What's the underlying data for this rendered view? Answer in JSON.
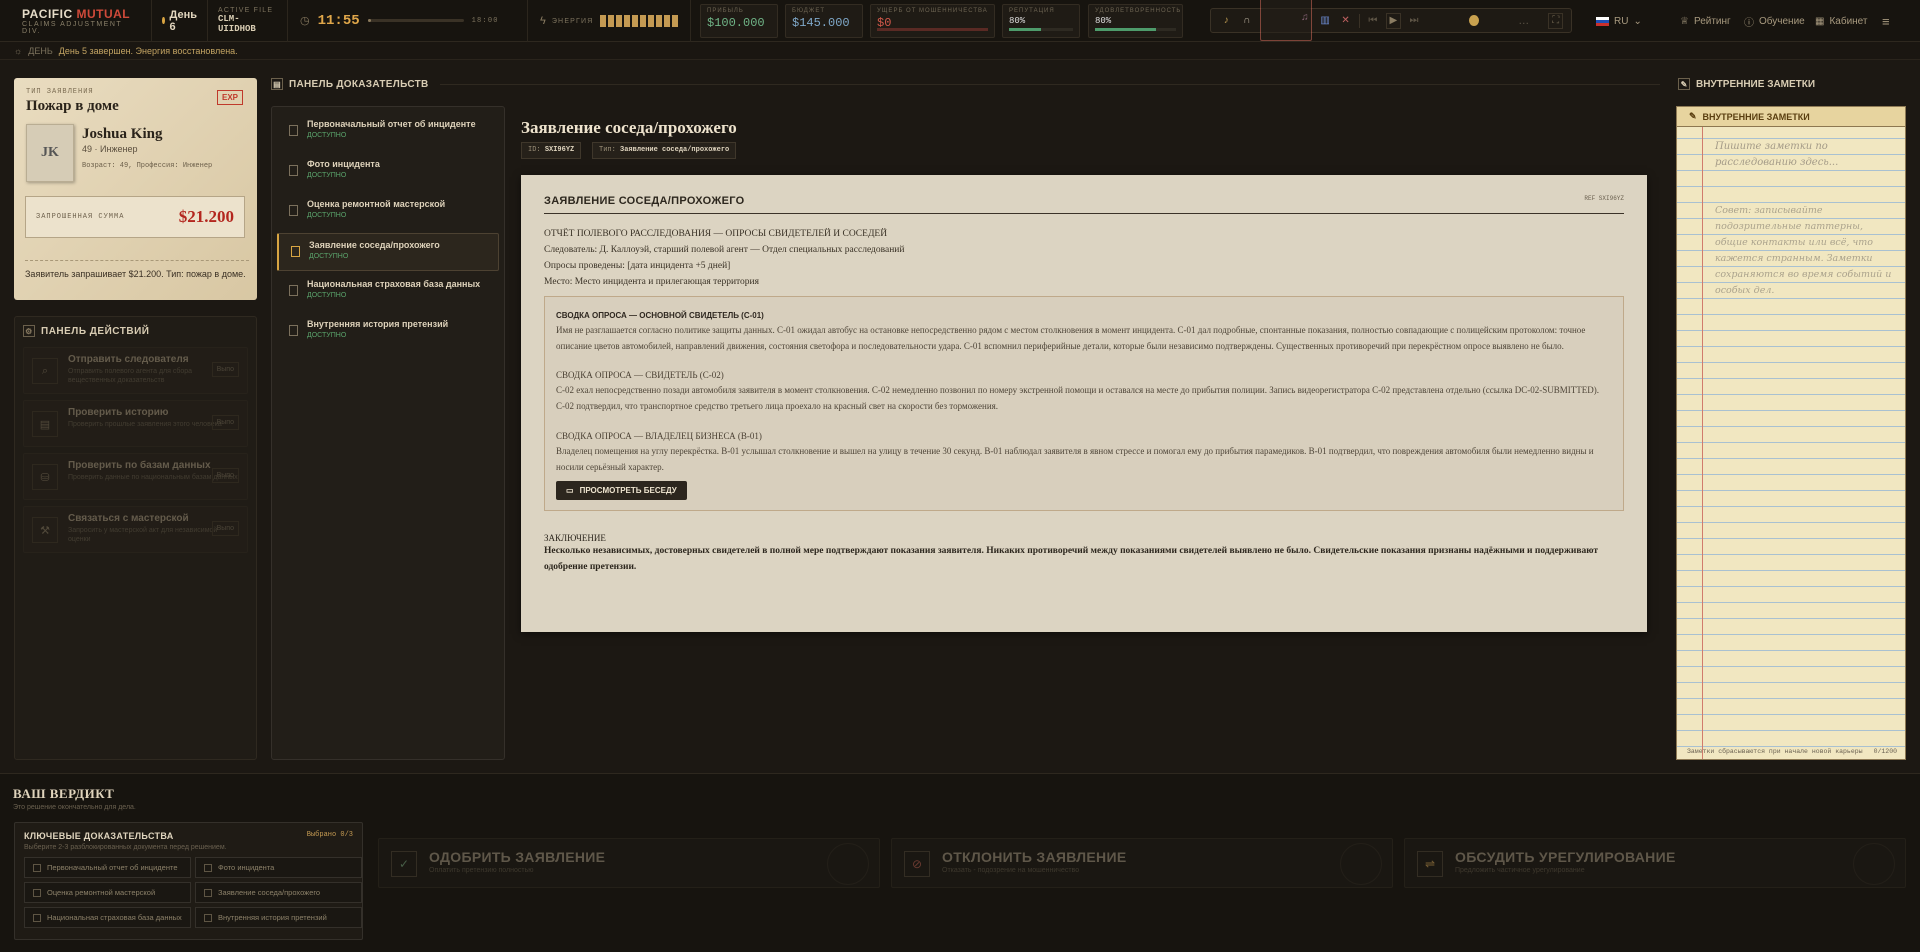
{
  "topbar": {
    "brand_main": "PACIFIC",
    "brand_accent": "MUTUAL",
    "brand_sub": "CLAIMS ADJUSTMENT DIV.",
    "day": "День 6",
    "active_file_label": "ACTIVE FILE",
    "active_file": "CLM-UIIDHOB",
    "time": "11:55",
    "time_end": "18:00",
    "day_progress": 0.04,
    "energy_label": "ЭНЕРГИЯ",
    "energy_segments": 10,
    "stats": {
      "profit_label": "ПРИБЫЛЬ",
      "profit": "$100.000",
      "budget_label": "БЮДЖЕТ",
      "budget": "$145.000",
      "fraud_label": "УЩЕРБ ОТ МОШЕННИЧЕСТВА",
      "fraud": "$0",
      "reputation_label": "РЕПУТАЦИЯ",
      "reputation": "80%",
      "satisfaction_label": "УДОВЛЕТВОРЕННОСТЬ",
      "satisfaction": "80%"
    },
    "language": "RU",
    "nav": {
      "rating": "Рейтинг",
      "training": "Обучение",
      "cabinet": "Кабинет"
    }
  },
  "notification": {
    "label": "ДЕНЬ",
    "text": "День 5 завершен. Энергия восстановлена."
  },
  "claim": {
    "type_label": "ТИП ЗАЯВЛЕНИЯ",
    "type": "Пожар в доме",
    "badge": "EXP",
    "initials": "JK",
    "name": "Joshua King",
    "info": "49 · Инженер",
    "meta": "Возраст: 49, Профессия: Инженер",
    "sum_label": "ЗАПРОШЕННАЯ СУММА",
    "sum": "$21.200",
    "description": "Заявитель запрашивает $21.200. Тип: пожар в доме."
  },
  "actions": {
    "title": "ПАНЕЛЬ ДЕЙСТВИЙ",
    "items": [
      {
        "title": "Отправить следователя",
        "desc": "Отправить полевого агента для сбора вещественных доказательств",
        "btn": "Выпо"
      },
      {
        "title": "Проверить историю",
        "desc": "Проверить прошлые заявления этого человека",
        "btn": "Выпо"
      },
      {
        "title": "Проверить по базам данных",
        "desc": "Проверить данные по национальным базам данных",
        "btn": "Выпо"
      },
      {
        "title": "Связаться с мастерской",
        "desc": "Запросить у мастерской акт для независимой оценки",
        "btn": "Выпо"
      }
    ]
  },
  "evidence": {
    "title": "ПАНЕЛЬ ДОКАЗАТЕЛЬСТВ",
    "items": [
      {
        "title": "Первоначальный отчет об инциденте",
        "status": "ДОСТУПНО"
      },
      {
        "title": "Фото инцидента",
        "status": "ДОСТУПНО"
      },
      {
        "title": "Оценка ремонтной мастерской",
        "status": "ДОСТУПНО"
      },
      {
        "title": "Заявление соседа/прохожего",
        "status": "ДОСТУПНО"
      },
      {
        "title": "Национальная страховая база данных",
        "status": "ДОСТУПНО"
      },
      {
        "title": "Внутренняя история претензий",
        "status": "ДОСТУПНО"
      }
    ]
  },
  "document": {
    "title": "Заявление соседа/прохожего",
    "id_label": "ID:",
    "id": "SXI96YZ",
    "type_label": "Тип:",
    "type": "Заявление соседа/прохожего",
    "header": "ЗАЯВЛЕНИЕ СОСЕДА/ПРОХОЖЕГО",
    "ref": "REF SXI96YZ",
    "meta": [
      "ОТЧЁТ ПОЛЕВОГО РАССЛЕДОВАНИЯ — ОПРОСЫ СВИДЕТЕЛЕЙ И СОСЕДЕЙ",
      "Следователь: Д. Каллоуэй, старший полевой агент — Отдел специальных расследований",
      "Опросы проведены: [дата инцидента +5 дней]",
      "Место: Место инцидента и прилегающая территория"
    ],
    "summary_title": "СВОДКА ОПРОСА — ОСНОВНОЙ СВИДЕТЕЛЬ (С-01)",
    "summary_text": "Имя не разглашается согласно политике защиты данных. С-01 ожидал автобус на остановке непосредственно рядом с местом столкновения в момент инцидента. С-01 дал подробные, спонтанные показания, полностью совпадающие с полицейским протоколом: точное описание цветов автомобилей, направлений движения, состояния светофора и последовательности удара. С-01 вспомнил периферийные детали, которые были независимо подтверждены. Существенных противоречий при перекрёстном опросе выявлено не было.",
    "w2_title": "СВОДКА ОПРОСА — СВИДЕТЕЛЬ (С-02)",
    "w2_text": "С-02 ехал непосредственно позади автомобиля заявителя в момент столкновения. С-02 немедленно позвонил по номеру экстренной помощи и оставался на месте до прибытия полиции. Запись видеорегистратора С-02 представлена отдельно (ссылка DC-02-SUBMITTED). С-02 подтвердил, что транспортное средство третьего лица проехало на красный свет на скорости без торможения.",
    "w3_title": "СВОДКА ОПРОСА — ВЛАДЕЛЕЦ БИЗНЕСА (В-01)",
    "w3_text": "Владелец помещения на углу перекрёстка. В-01 услышал столкновение и вышел на улицу в течение 30 секунд. В-01 наблюдал заявителя в явном стрессе и помогал ему до прибытия парамедиков. В-01 подтвердил, что повреждения автомобиля были немедленно видны и носили серьёзный характер.",
    "conv_button": "ПРОСМОТРЕТЬ БЕСЕДУ",
    "conclusion_title": "ЗАКЛЮЧЕНИЕ",
    "conclusion": "Несколько независимых, достоверных свидетелей в полной мере подтверждают показания заявителя. Никаких противоречий между показаниями свидетелей выявлено не было. Свидетельские показания признаны надёжными и поддерживают одобрение претензии."
  },
  "notes": {
    "title": "ВНУТРЕННИЕ ЗАМЕТКИ",
    "inner_title": "ВНУТРЕННИЕ ЗАМЕТКИ",
    "placeholder": "Пишите заметки по расследованию здесь...",
    "tip": "Совет: записывайте подозрительные паттерны, общие контакты или всё, что кажется странным. Заметки сохраняются во время событий и особых дел.",
    "footer_left": "Заметки сбрасываются при начале новой карьеры",
    "footer_right": "0/1200"
  },
  "verdict": {
    "title": "ВАШ ВЕРДИКТ",
    "subtitle": "Это решение окончательно для дела.",
    "key_title": "КЛЮЧЕВЫЕ ДОКАЗАТЕЛЬСТВА",
    "key_count": "Выбрано 0/3",
    "key_sub": "Выберите 2-3 разблокированных документа перед решением.",
    "key_items": [
      "Первоначальный отчет об инциденте",
      "Фото инцидента",
      "Оценка ремонтной мастерской",
      "Заявление соседа/прохожего",
      "Национальная страховая база данных",
      "Внутренняя история претензий"
    ],
    "approve": "ОДОБРИТЬ ЗАЯВЛЕНИЕ",
    "approve_sub": "Оплатить претензию полностью",
    "reject": "ОТКЛОНИТЬ ЗАЯВЛЕНИЕ",
    "reject_sub": "Отказать - подозрение на мошенничество",
    "settle": "ОБСУДИТЬ УРЕГУЛИРОВАНИЕ",
    "settle_sub": "Предложить частичное урегулирование"
  }
}
